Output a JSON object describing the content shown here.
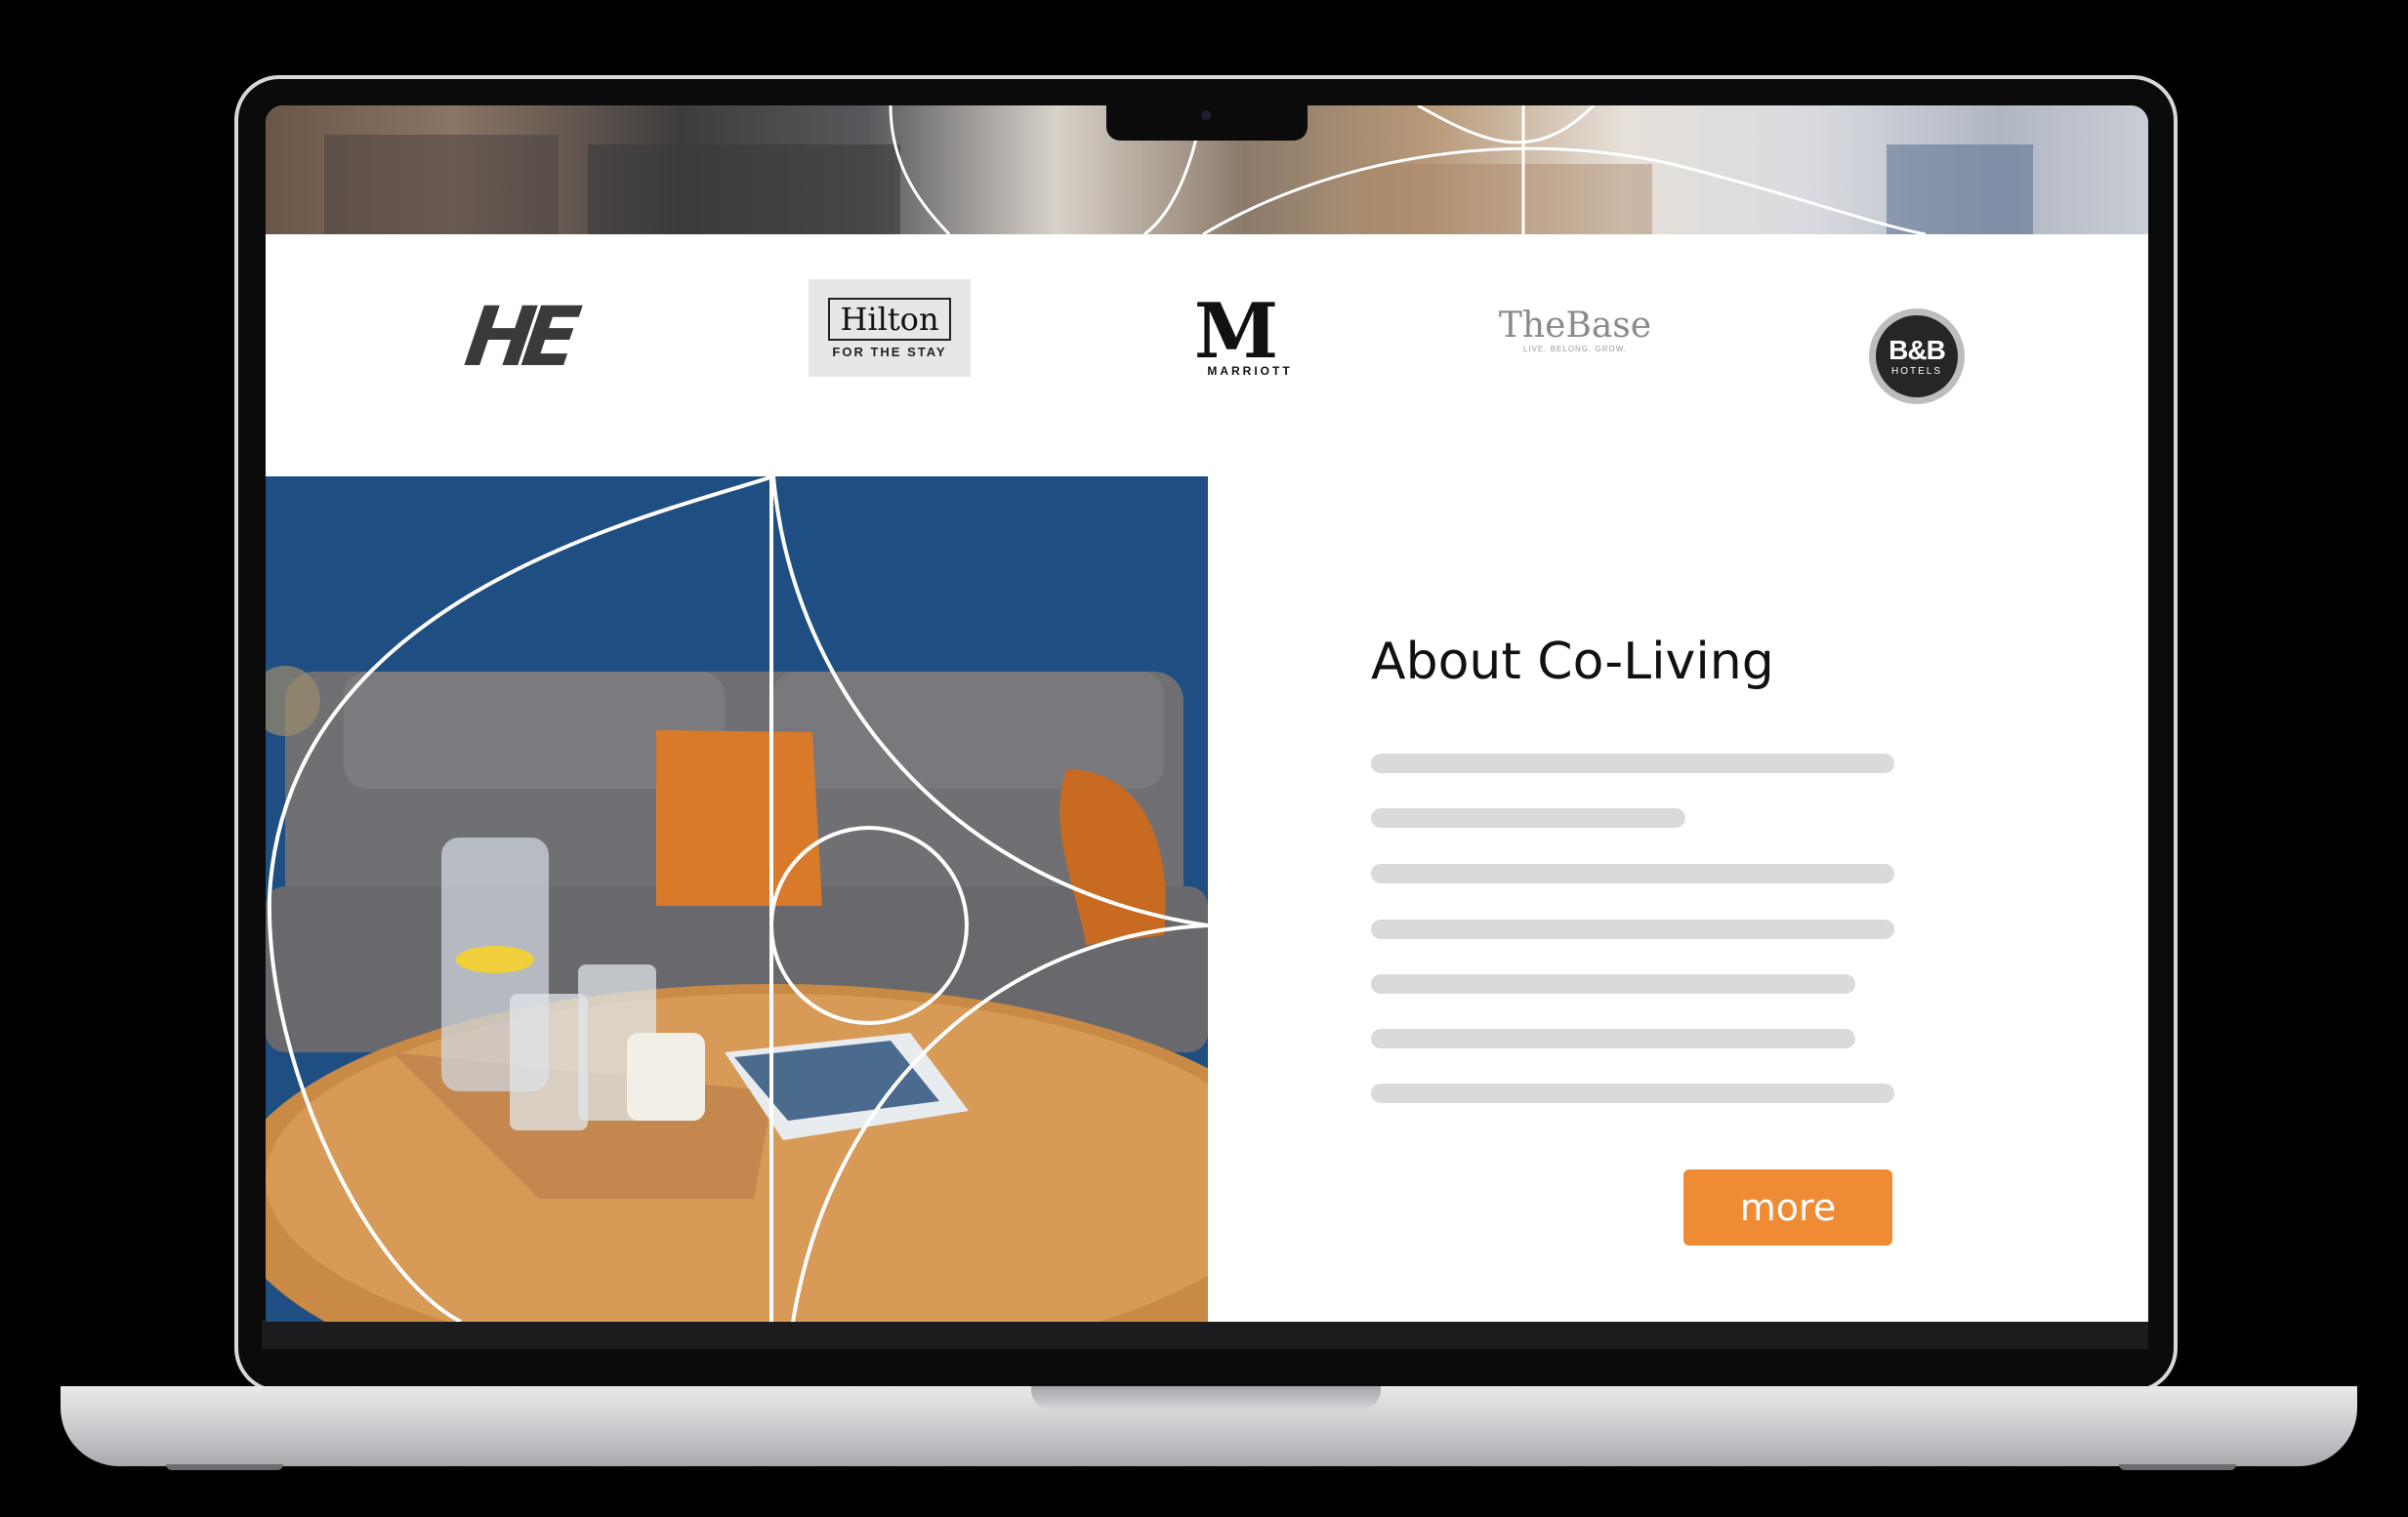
{
  "section": {
    "title": "About Co-Living",
    "more_label": "more"
  },
  "logos": [
    {
      "name": "HE",
      "text": "HE"
    },
    {
      "name": "Hilton",
      "text": "Hilton",
      "tagline": "FOR THE STAY"
    },
    {
      "name": "Marriott",
      "mark": "M",
      "text": "MARRIOTT"
    },
    {
      "name": "TheBase",
      "text": "TheBase",
      "tagline": "LIVE. BELONG. GROW."
    },
    {
      "name": "B&B Hotels",
      "text": "B&B",
      "tagline": "HOTELS"
    }
  ],
  "colors": {
    "accent": "#ef8a35",
    "placeholder_line": "#dadada",
    "wall_blue": "#1e4d80"
  }
}
